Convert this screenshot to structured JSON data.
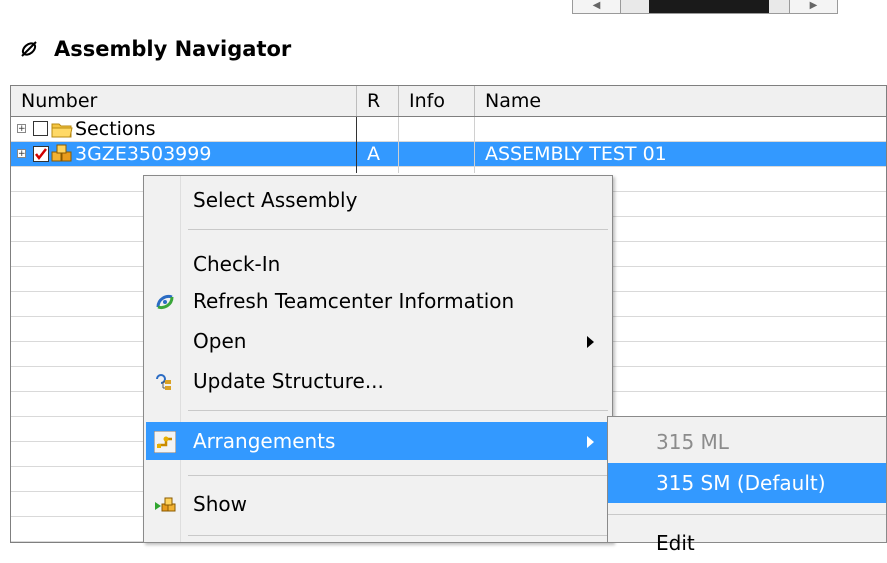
{
  "panel": {
    "title": "Assembly Navigator",
    "columns": {
      "number": "Number",
      "r": "R",
      "info": "Info",
      "name": "Name"
    }
  },
  "rows": [
    {
      "number": "Sections",
      "r": "",
      "info": "",
      "name": ""
    },
    {
      "number": "3GZE3503999",
      "r": "A",
      "info": "",
      "name": "ASSEMBLY TEST 01"
    }
  ],
  "context_menu": {
    "select_assembly": "Select Assembly",
    "check_in": "Check-In",
    "refresh": "Refresh Teamcenter Information",
    "open": "Open",
    "update_structure": "Update Structure...",
    "arrangements": "Arrangements",
    "show": "Show"
  },
  "arrangements_submenu": {
    "item1": "315 ML",
    "item2": "315 SM (Default)",
    "item3": "Edit"
  },
  "colors": {
    "selection": "#3399ff",
    "menu_bg": "#f1f1f1"
  }
}
